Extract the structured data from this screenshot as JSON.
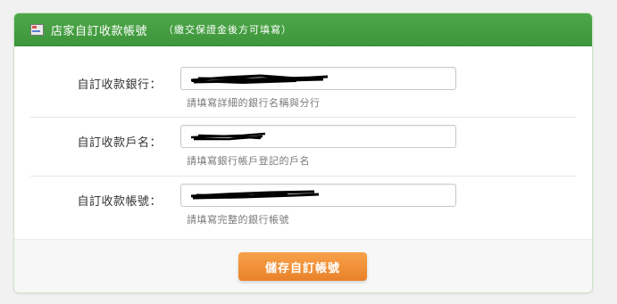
{
  "header": {
    "icon": "store-icon",
    "title": "店家自訂收款帳號",
    "note": "（繳交保證金後方可填寫）"
  },
  "fields": [
    {
      "label": "自訂收款銀行：",
      "value": "",
      "help": "請填寫詳細的銀行名稱與分行"
    },
    {
      "label": "自訂收款戶名：",
      "value": "",
      "help": "請填寫銀行帳戶登記的戶名"
    },
    {
      "label": "自訂收款帳號：",
      "value": "",
      "help": "請填寫完整的銀行帳號"
    }
  ],
  "actions": {
    "save_label": "儲存自訂帳號"
  }
}
